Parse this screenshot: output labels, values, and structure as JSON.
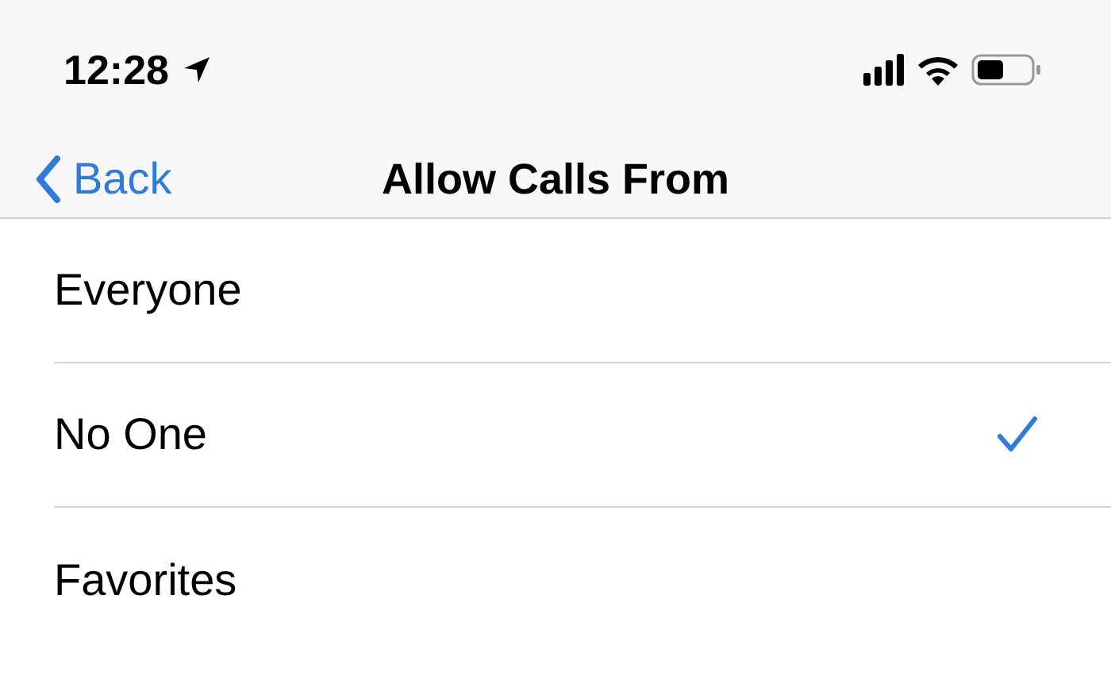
{
  "status_bar": {
    "time": "12:28"
  },
  "nav_bar": {
    "back": "Back",
    "title": "Allow Calls From"
  },
  "options": [
    {
      "label": "Everyone",
      "selected": false
    },
    {
      "label": "No One",
      "selected": true
    },
    {
      "label": "Favorites",
      "selected": false
    }
  ]
}
